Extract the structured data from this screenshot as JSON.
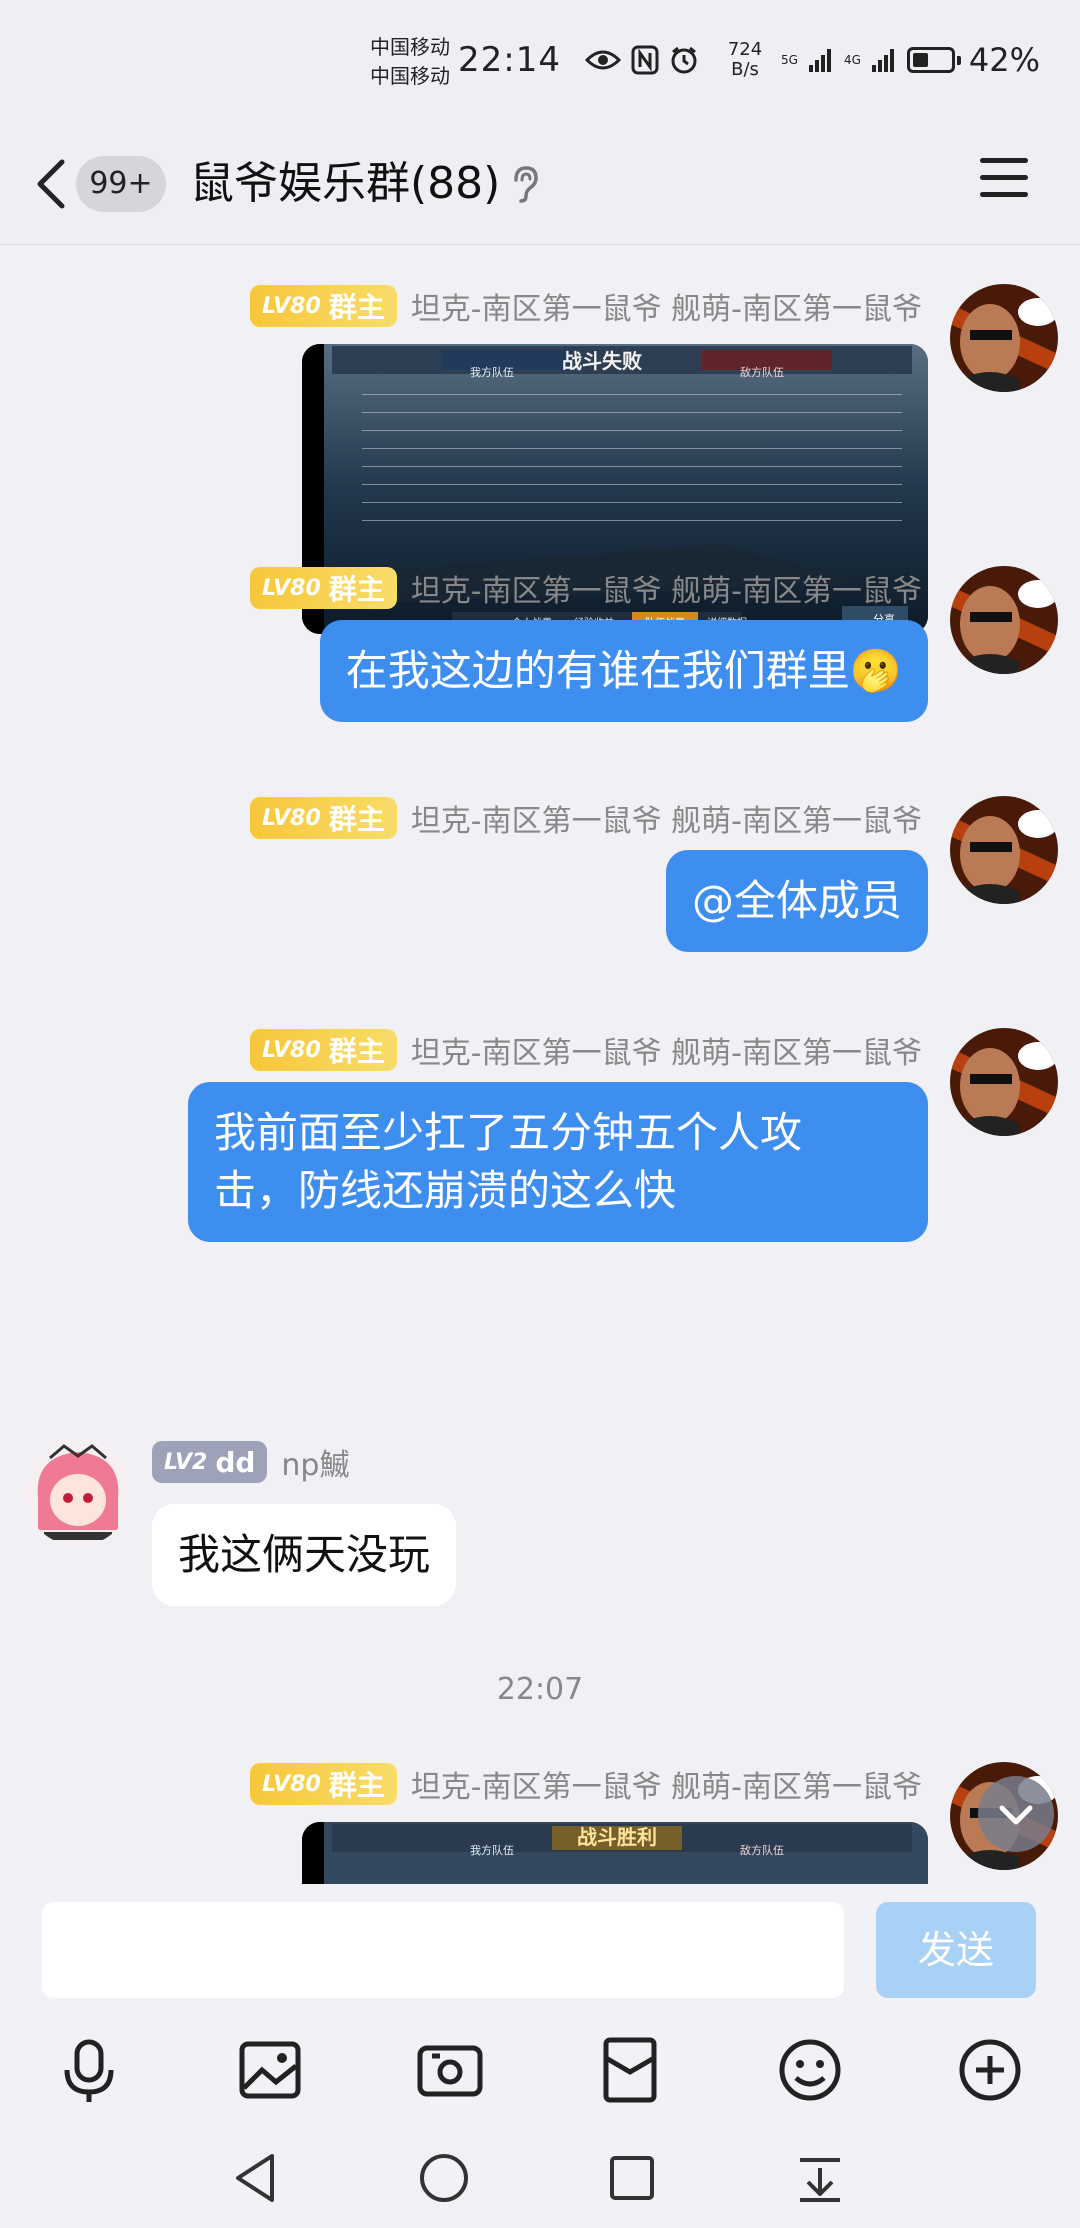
{
  "status_bar": {
    "carrier_1": "中国移动",
    "carrier_2": "中国移动",
    "time": "22:14",
    "net_speed_value": "724",
    "net_speed_unit": "B/s",
    "sim1_type": "5G",
    "sim2_type": "4G",
    "battery_percent": "42%",
    "battery_level": 0.42
  },
  "header": {
    "unread_count": "99+",
    "group_title": "鼠爷娱乐群(88)"
  },
  "messages": [
    {
      "type": "image",
      "badge_level": "LV80",
      "badge_role": "群主",
      "sender": "坦克-南区第一鼠爷 舰萌-南区第一鼠爷",
      "image_banner": "战斗失败",
      "image_left_team": "我方队伍",
      "image_right_team": "敌方队伍",
      "image_tabs": [
        "个人战果",
        "经验收益",
        "队伍战果",
        "详细数据"
      ],
      "image_share": "分享"
    },
    {
      "type": "text",
      "badge_level": "LV80",
      "badge_role": "群主",
      "sender": "坦克-南区第一鼠爷 舰萌-南区第一鼠爷",
      "text": "在我这边的有谁在我们群里🫢"
    },
    {
      "type": "text",
      "badge_level": "LV80",
      "badge_role": "群主",
      "sender": "坦克-南区第一鼠爷 舰萌-南区第一鼠爷",
      "text": "@全体成员"
    },
    {
      "type": "text",
      "badge_level": "LV80",
      "badge_role": "群主",
      "sender": "坦克-南区第一鼠爷 舰萌-南区第一鼠爷",
      "text_line_1": "我前面至少扛了五分钟五个人攻",
      "text_line_2": "击，防线还崩溃的这么快"
    },
    {
      "type": "text",
      "badge_level": "LV2",
      "badge_role": "dd",
      "sender": "np鰄",
      "text": "我这俩天没玩"
    },
    {
      "type": "image",
      "badge_level": "LV80",
      "badge_role": "群主",
      "sender": "坦克-南区第一鼠爷 舰萌-南区第一鼠爷",
      "image_banner": "战斗胜利",
      "image_left_team": "我方队伍",
      "image_right_team": "敌方队伍"
    }
  ],
  "timestamp": "22:07",
  "input": {
    "placeholder": "",
    "send_label": "发送"
  },
  "toolbar_icons": [
    "microphone-icon",
    "image-icon",
    "camera-icon",
    "red-packet-icon",
    "emoji-icon",
    "plus-icon"
  ],
  "colors": {
    "bubble_blue": "#3e8ef0",
    "owner_badge": "#f7c73a",
    "send_button": "#a9d1f5"
  }
}
